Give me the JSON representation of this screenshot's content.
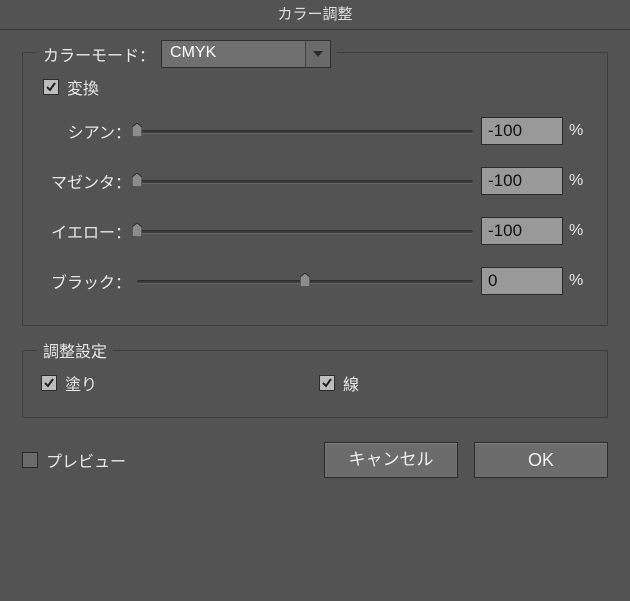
{
  "title": "カラー調整",
  "colorMode": {
    "label": "カラーモード：",
    "selected": "CMYK"
  },
  "convert": {
    "checked": true,
    "label": "変換"
  },
  "sliders": {
    "cyan": {
      "label": "シアン：",
      "value": "-100",
      "pos": 0,
      "unit": "%"
    },
    "magenta": {
      "label": "マゼンタ：",
      "value": "-100",
      "pos": 0,
      "unit": "%"
    },
    "yellow": {
      "label": "イエロー：",
      "value": "-100",
      "pos": 0,
      "unit": "%"
    },
    "black": {
      "label": "ブラック：",
      "value": "0",
      "pos": 50,
      "unit": "%"
    }
  },
  "adjustGroup": {
    "legend": "調整設定",
    "fill": {
      "checked": true,
      "label": "塗り"
    },
    "stroke": {
      "checked": true,
      "label": "線"
    }
  },
  "preview": {
    "checked": false,
    "label": "プレビュー"
  },
  "buttons": {
    "cancel": "キャンセル",
    "ok": "OK"
  }
}
